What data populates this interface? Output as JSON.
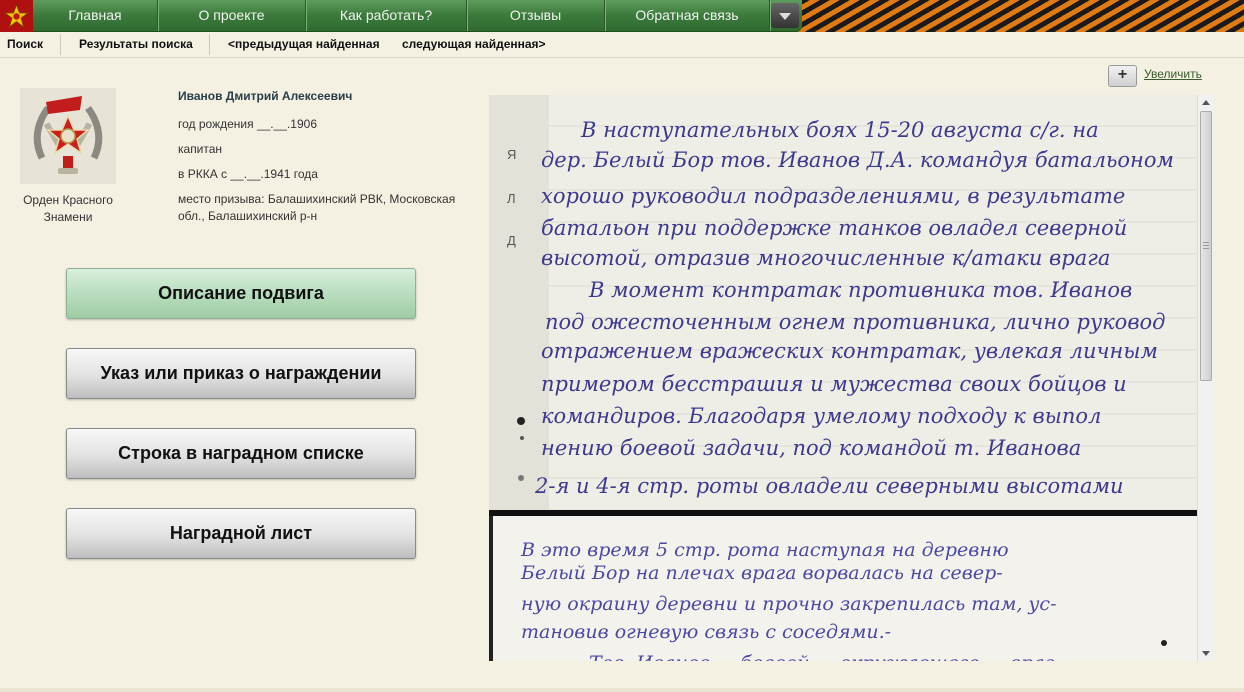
{
  "nav": {
    "logo_icon": "red-star-emblem-icon",
    "items": [
      "Главная",
      "О проекте",
      "Как работать?",
      "Отзывы",
      "Обратная связь"
    ],
    "more_icon": "chevron-down-icon"
  },
  "subnav": {
    "search": "Поиск",
    "results": "Результаты поиска",
    "prev": "<предыдущая найденная",
    "next": "следующая найденная>"
  },
  "award": {
    "name": "Орден Красного Знамени",
    "icon": "order-red-banner-icon"
  },
  "person": {
    "name": "Иванов Дмитрий Алексеевич",
    "birth": "год рождения __.__.1906",
    "rank": "капитан",
    "service": "в РККА с __.__.1941 года",
    "enlistment": "место призыва: Балашихинский РВК, Московская обл., Балашихинский р-н"
  },
  "buttons": {
    "feat": "Описание подвига",
    "decree": "Указ или приказ о награждении",
    "list_row": "Строка в наградном списке",
    "award_sheet": "Наградной лист"
  },
  "viewer": {
    "zoom_label": "Увеличить",
    "zoom_icon": "plus-icon",
    "margin_letters": [
      "Я",
      "Л",
      "Д"
    ],
    "lines_top": [
      "В наступательных боях 15-20 августа с/г. на",
      "дер. Белый Бор тов. Иванов Д.А. командуя батальоном",
      "хорошо руководил подразделениями, в результате",
      "батальон при поддержке танков овладел северной",
      "высотой, отразив многочисленные к/атаки врага",
      "В момент контратак противника тов. Иванов",
      "под ожесточенным огнем противника, лично руковод",
      "отражением вражеских контратак, увлекая личным",
      "примером бесстрашия и мужества своих бойцов и",
      "командиров. Благодаря умелому подходу к выпол",
      "нению боевой задачи, под командой т. Иванова",
      "2-я и 4-я стр. роты овладели северными высотами"
    ],
    "lines_bottom": [
      "В это время 5 стр. рота наступая на деревню",
      "Белый Бор на плечах врага ворвалась на север-",
      "ную окраину деревни и прочно закрепилась там, ус-",
      "тановив огневую связь с соседями.-",
      "Тов. Иванов ... боевой ... окружавшего ... враг"
    ]
  },
  "colors": {
    "nav_green": "#3c7a3c",
    "button_active": "#b6dcbc",
    "ink": "#3c3a8c",
    "page_bg": "#f4f0e2"
  }
}
